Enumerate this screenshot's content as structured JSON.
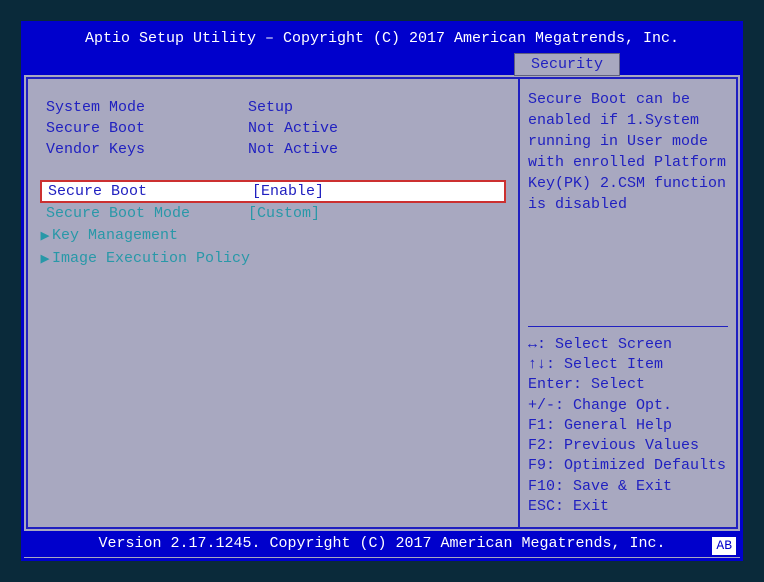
{
  "header": {
    "title": "Aptio Setup Utility – Copyright (C) 2017 American Megatrends, Inc.",
    "tab": "Security"
  },
  "main": {
    "info": [
      {
        "label": "System Mode",
        "value": "Setup"
      },
      {
        "label": "Secure Boot",
        "value": "Not Active"
      },
      {
        "label": "Vendor Keys",
        "value": "Not Active"
      }
    ],
    "selected": {
      "label": "Secure Boot",
      "value": "[Enable]"
    },
    "options": [
      {
        "label": "Secure Boot Mode",
        "value": "[Custom]"
      }
    ],
    "submenus": [
      "Key Management",
      "Image Execution Policy"
    ]
  },
  "side": {
    "help": "Secure Boot can be enabled if 1.System running in User mode with enrolled Platform Key(PK) 2.CSM function is disabled",
    "keys": [
      "↔: Select Screen",
      "↑↓: Select Item",
      "Enter: Select",
      "+/-: Change Opt.",
      "F1: General Help",
      "F2: Previous Values",
      "F9: Optimized Defaults",
      "F10: Save & Exit",
      "ESC: Exit"
    ]
  },
  "footer": {
    "text": "Version 2.17.1245. Copyright (C) 2017 American Megatrends, Inc.",
    "badge": "AB"
  }
}
